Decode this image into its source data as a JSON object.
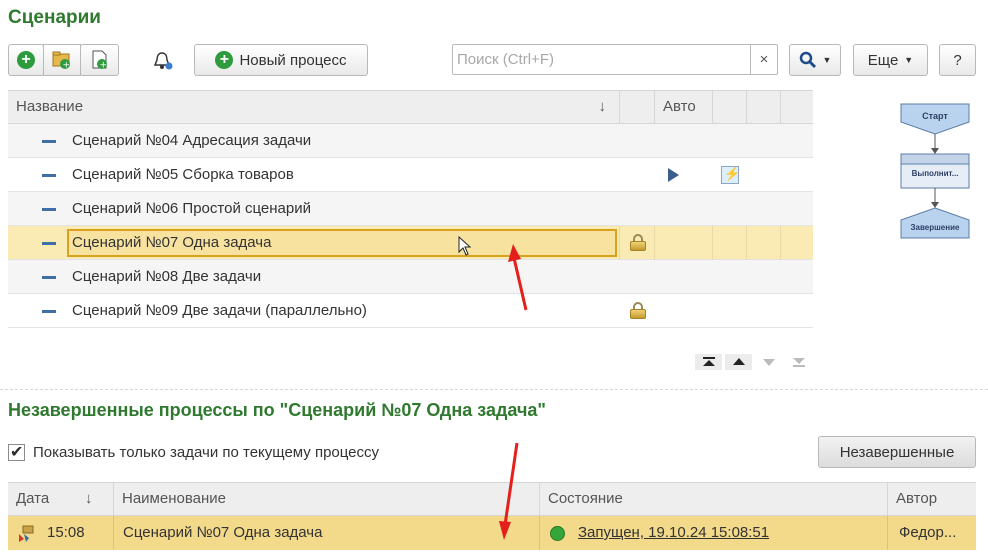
{
  "page": {
    "title": "Сценарии"
  },
  "toolbar": {
    "new_process_label": "Новый процесс",
    "search_placeholder": "Поиск (Ctrl+F)",
    "clear_label": "×",
    "more_label": "Еще",
    "help_label": "?"
  },
  "grid": {
    "columns": {
      "name": "Название",
      "sort_indicator": "↓",
      "auto": "Авто"
    },
    "rows": [
      {
        "name": "Сценарий №04 Адресация задачи"
      },
      {
        "name": "Сценарий №05 Сборка товаров"
      },
      {
        "name": "Сценарий №06 Простой сценарий"
      },
      {
        "name": "Сценарий №07 Одна задача"
      },
      {
        "name": "Сценарий №08 Две задачи"
      },
      {
        "name": "Сценарий №09 Две задачи (параллельно)"
      }
    ]
  },
  "flow": {
    "start": "Старт",
    "task": "Выполнит...",
    "end": "Завершение"
  },
  "processes": {
    "title": "Незавершенные процессы по \"Сценарий №07 Одна задача\"",
    "checkbox_label": "Показывать только задачи по текущему процессу",
    "filter_button": "Незавершенные",
    "columns": {
      "date": "Дата",
      "sort_indicator": "↓",
      "name": "Наименование",
      "state": "Состояние",
      "author": "Автор"
    },
    "rows": [
      {
        "time": "15:08",
        "name": "Сценарий №07 Одна задача",
        "state": "Запущен, 19.10.24 15:08:51",
        "author": "Федор..."
      }
    ]
  },
  "colors": {
    "accent_green": "#2f7a2f",
    "selection": "#faeab4",
    "annotation_arrow": "#e3201b"
  },
  "icons": [
    "add-icon",
    "add-folder-icon",
    "add-copy-icon",
    "bell-icon",
    "search-icon",
    "lock-icon",
    "play-icon",
    "auto-run-icon",
    "process-icon"
  ]
}
